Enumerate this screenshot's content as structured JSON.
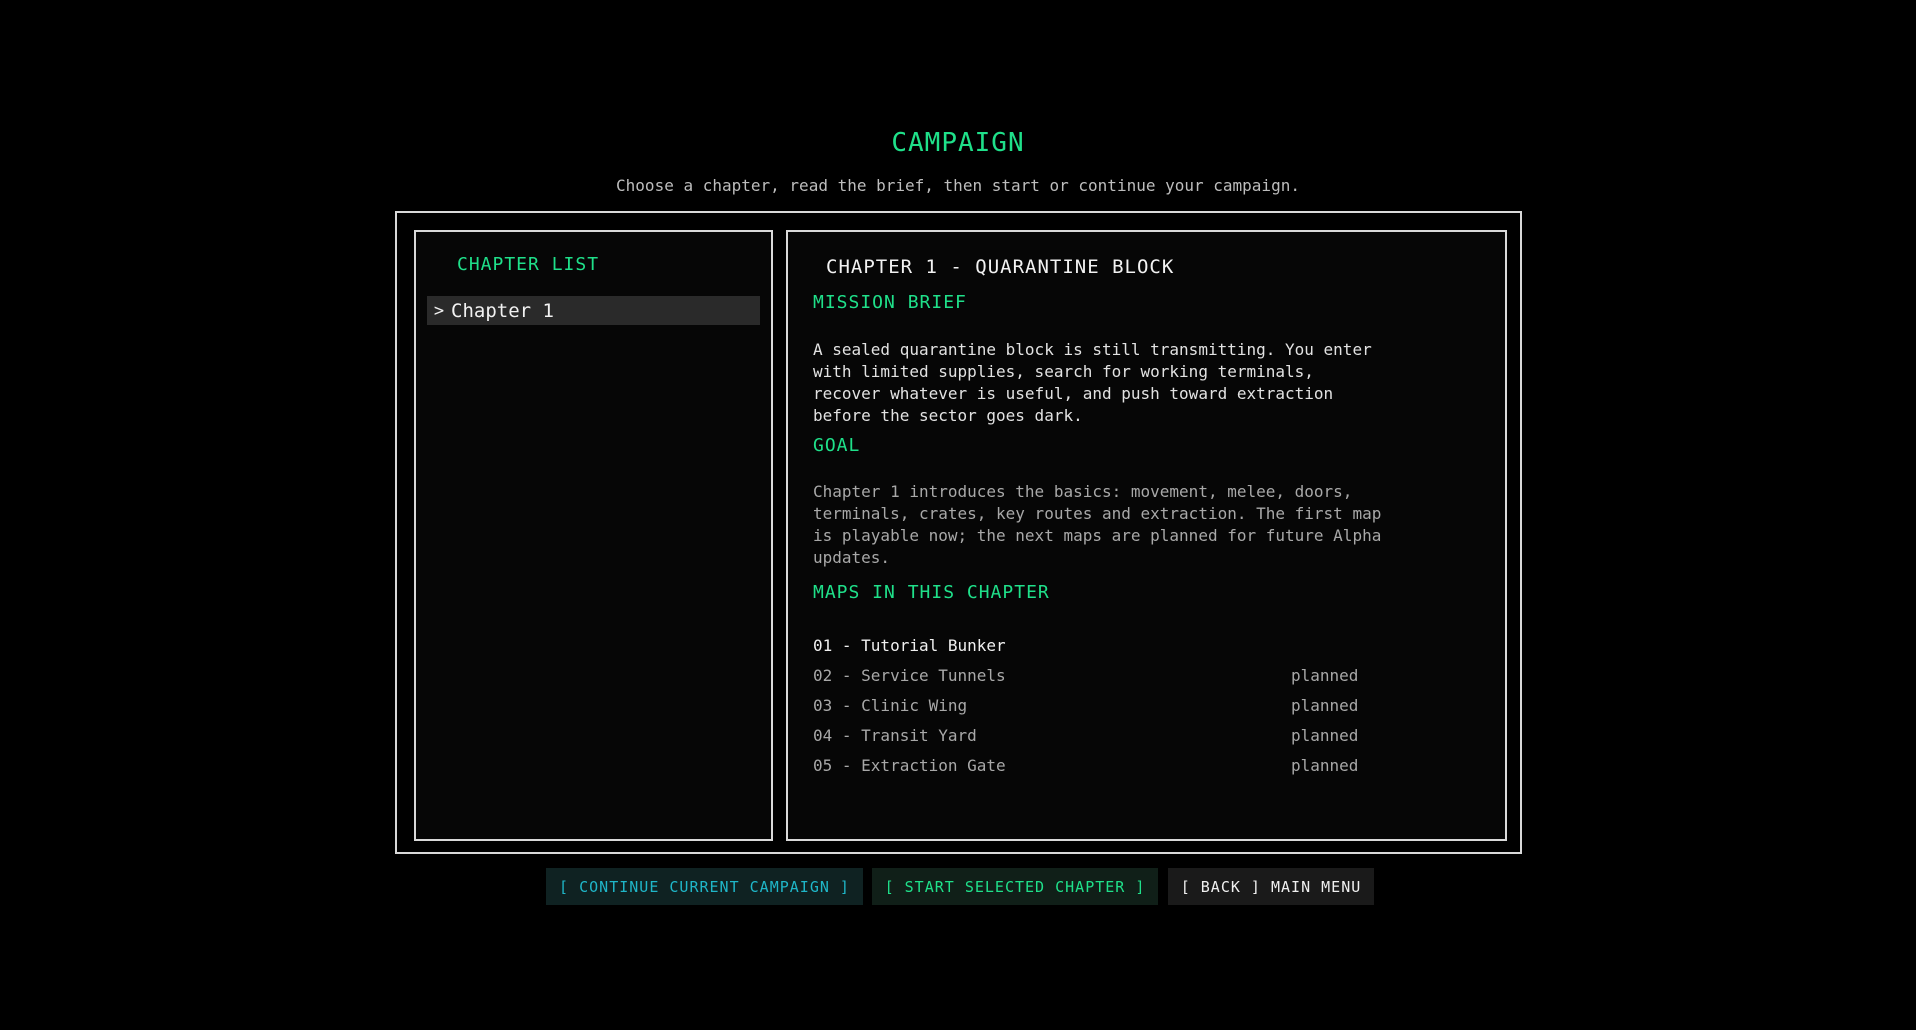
{
  "header": {
    "title": "CAMPAIGN",
    "subtitle": "Choose a chapter, read the brief, then start or continue your campaign."
  },
  "chapter_list": {
    "heading": "CHAPTER LIST",
    "items": [
      {
        "caret": ">",
        "label": "Chapter 1",
        "selected": true
      }
    ]
  },
  "detail": {
    "chapter_title": "CHAPTER 1 - QUARANTINE BLOCK",
    "mission_brief_heading": "MISSION BRIEF",
    "mission_brief_lines": [
      "A sealed quarantine block is still transmitting. You enter",
      "with limited supplies, search for working terminals,",
      "recover whatever is useful, and push toward extraction",
      "before the sector goes dark."
    ],
    "goal_heading": "GOAL",
    "goal_lines": [
      "Chapter 1 introduces the basics: movement, melee, doors,",
      "terminals, crates, key routes and extraction. The first map",
      "is playable now; the next maps are planned for future Alpha",
      "updates."
    ],
    "maps_heading": "MAPS IN THIS CHAPTER",
    "maps": [
      {
        "name": "01 - Tutorial Bunker",
        "status": ""
      },
      {
        "name": "02 - Service Tunnels",
        "status": "planned"
      },
      {
        "name": "03 - Clinic Wing",
        "status": "planned"
      },
      {
        "name": "04 - Transit Yard",
        "status": "planned"
      },
      {
        "name": "05 - Extraction Gate",
        "status": "planned"
      }
    ]
  },
  "buttons": {
    "continue_label": "[ CONTINUE CURRENT CAMPAIGN ]",
    "start_label": "[ START SELECTED CHAPTER ]",
    "back_label": "[ BACK ] MAIN MENU"
  },
  "colors": {
    "accent_green": "#1fe08a",
    "accent_cyan": "#1fb6c8",
    "background": "#000000",
    "border": "#d9d9d9"
  }
}
